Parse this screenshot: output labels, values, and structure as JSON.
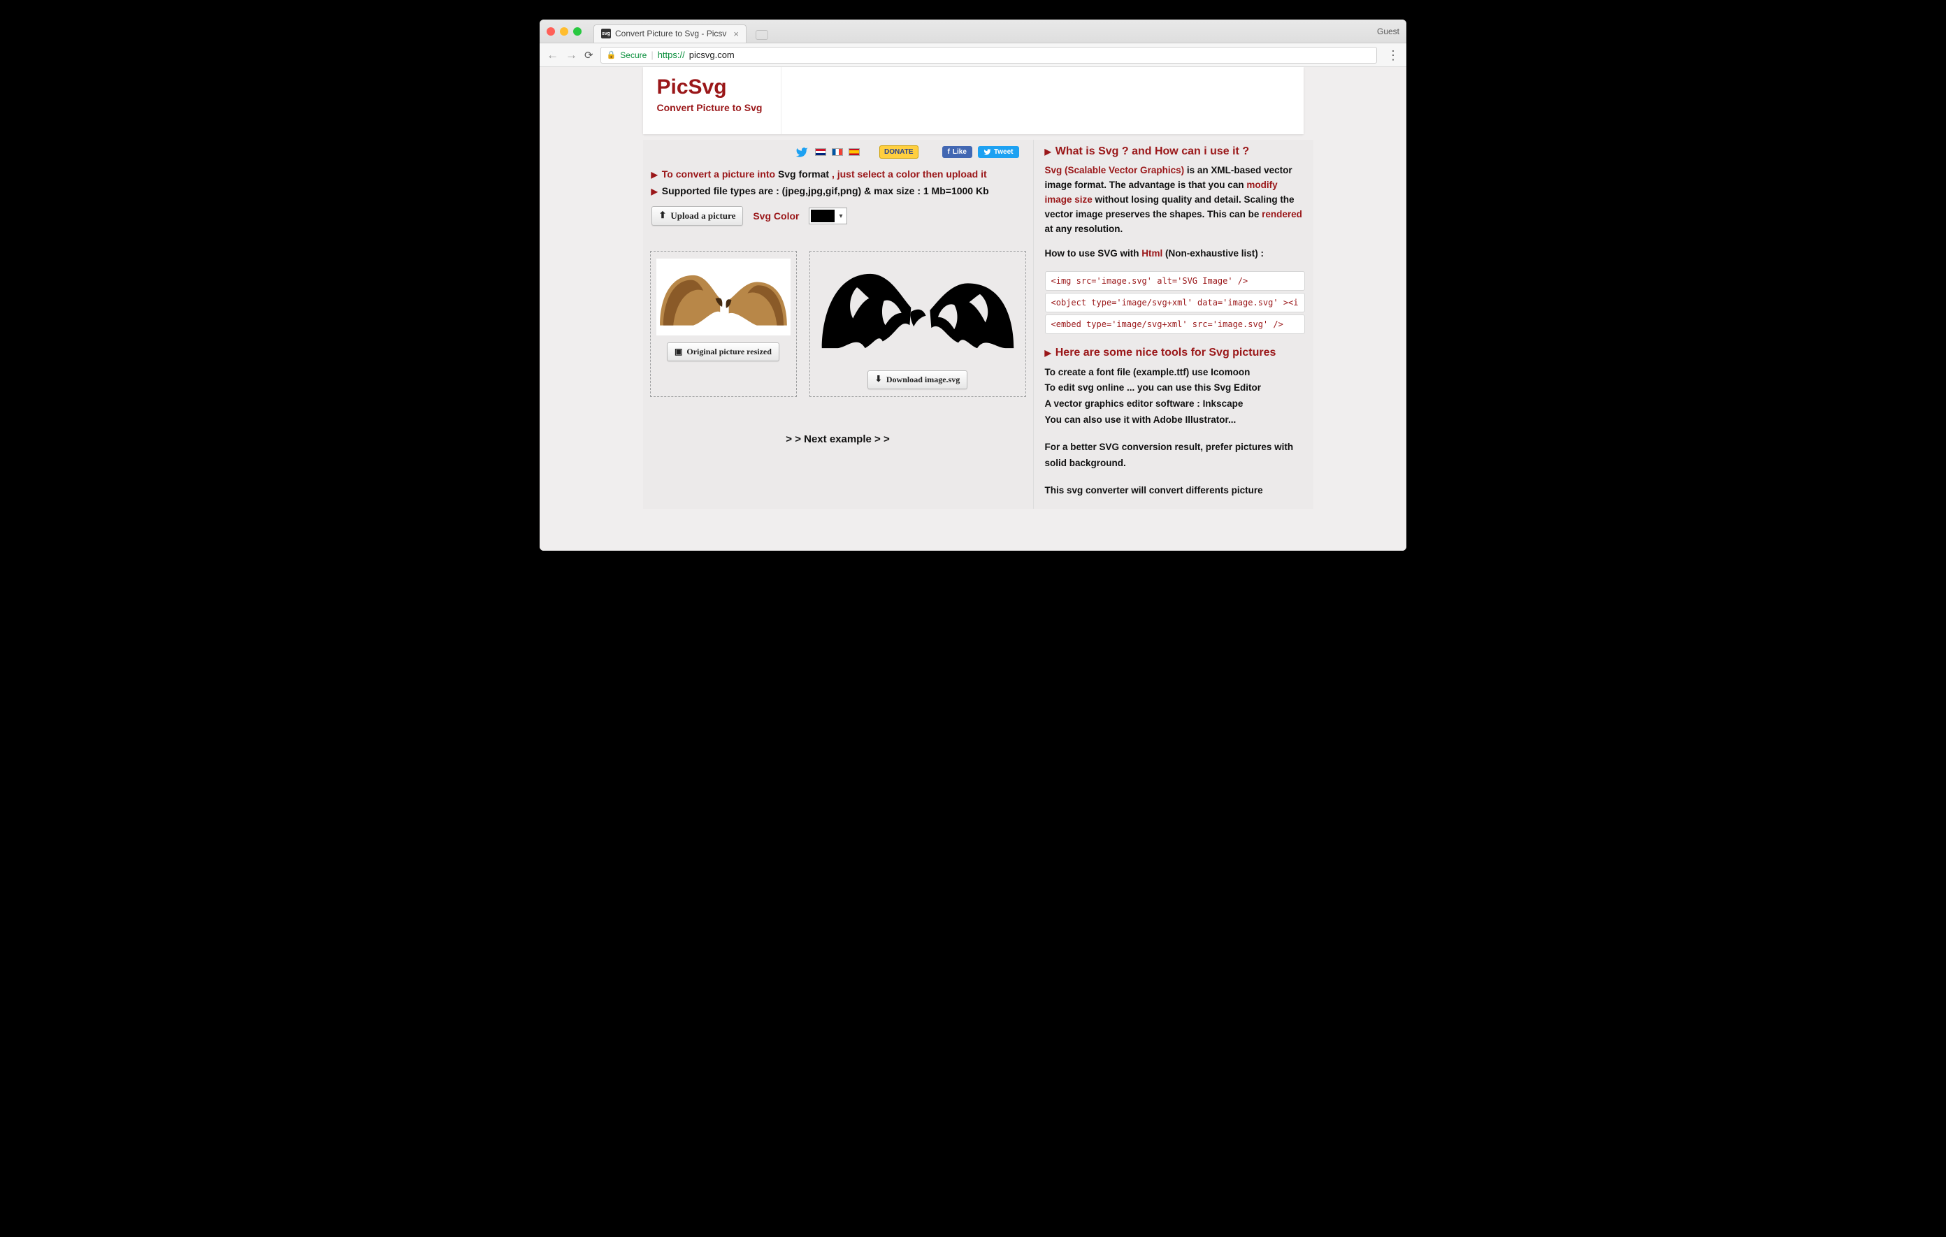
{
  "browser": {
    "guest_label": "Guest",
    "tab_title": "Convert Picture to Svg - Picsv",
    "secure_label": "Secure",
    "scheme": "https://",
    "host": "picsvg.com"
  },
  "brand": {
    "title": "PicSvg",
    "subtitle": "Convert Picture to Svg"
  },
  "social": {
    "donate": "DONATE",
    "like": "Like",
    "tweet": "Tweet"
  },
  "instructions": {
    "line1_pre": "To convert a picture into ",
    "line1_bold": "Svg format",
    "line1_post": " , just select a color then upload it",
    "line2": "Supported file types are : (jpeg,jpg,gif,png) & max size : 1 Mb=1000 Kb"
  },
  "controls": {
    "upload_label": "Upload a picture",
    "svgcolor_label": "Svg Color",
    "color_value": "#000000"
  },
  "panels": {
    "original_btn": "Original picture resized",
    "download_btn": "Download image.svg"
  },
  "next_example": "> > Next example > >",
  "right": {
    "h1": "What is Svg ? and How can i use it ?",
    "p1_a": "Svg (Scalable Vector Graphics)",
    "p1_b": " is an XML-based vector image format. The advantage is that you can ",
    "p1_c": "modify image size",
    "p1_d": " without losing quality and detail. Scaling the vector image preserves the shapes. This can be ",
    "p1_e": "rendered",
    "p1_f": " at any resolution.",
    "p2_a": "How to use SVG with ",
    "p2_b": "Html",
    "p2_c": " (Non-exhaustive list) :",
    "code1": "<img src='image.svg' alt='SVG Image' />",
    "code2": "<object type='image/svg+xml' data='image.svg' ><i",
    "code3": "<embed type='image/svg+xml' src='image.svg' />",
    "h2": "Here are some nice tools for Svg pictures",
    "t1_a": "To create a ",
    "t1_b": "font file (example.ttf)",
    "t1_c": " use ",
    "t1_d": "Icomoon",
    "t2_a": "To edit svg online ... you can use this ",
    "t2_b": "Svg Editor",
    "t3_a": "A vector graphics editor software : ",
    "t3_b": "Inkscape",
    "t4_a": "You can also use it with ",
    "t4_b": "Adobe Illustrator",
    "t4_c": "...",
    "t5": "For a better SVG conversion result, prefer pictures with solid background.",
    "t6": "This svg converter will convert differents picture"
  }
}
